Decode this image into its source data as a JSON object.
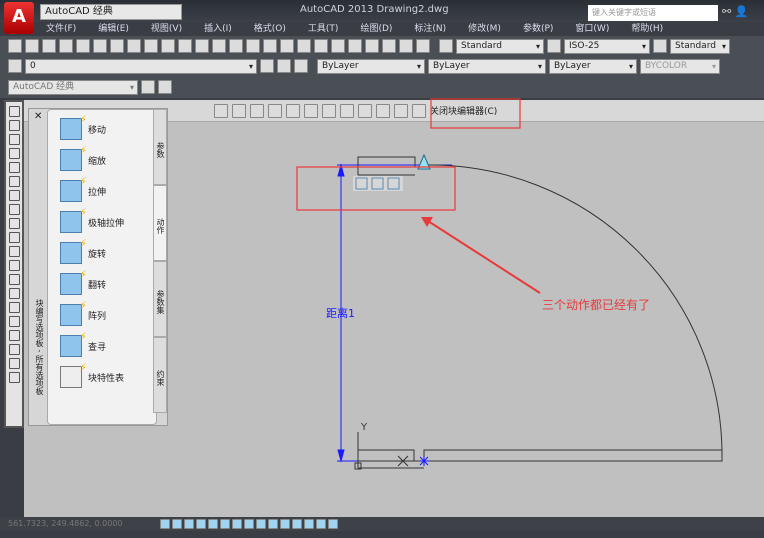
{
  "app": {
    "logo": "A",
    "workspace": "AutoCAD 经典",
    "title": "AutoCAD 2013   Drawing2.dwg",
    "search_placeholder": "键入关键字或短语"
  },
  "menu": [
    "文件(F)",
    "编辑(E)",
    "视图(V)",
    "插入(I)",
    "格式(O)",
    "工具(T)",
    "绘图(D)",
    "标注(N)",
    "修改(M)",
    "参数(P)",
    "窗口(W)",
    "帮助(H)"
  ],
  "styles": {
    "text_style": "Standard",
    "dim_style": "ISO-25",
    "table_style": "Standard"
  },
  "layers": {
    "layer": "0",
    "color": "ByLayer",
    "linetype": "ByLayer",
    "lineweight": "ByLayer",
    "plotstyle": "BYCOLOR"
  },
  "workspace2": "AutoCAD 经典",
  "block_editor": {
    "close_label": "关闭块编辑器(C)"
  },
  "palette": {
    "title": "块编写选项板 - 所有选项板",
    "items": [
      "移动",
      "缩放",
      "拉伸",
      "极轴拉伸",
      "旋转",
      "翻转",
      "阵列",
      "查寻",
      "块特性表"
    ],
    "tabs": [
      "参数",
      "动作",
      "参数集",
      "约束"
    ]
  },
  "drawing": {
    "dim_label": "距离1",
    "annotation": "三个动作都已经有了",
    "ucs_y": "Y",
    "accent_red": "#e8393a",
    "dim_blue": "#1a1aff"
  },
  "status": {
    "coords": "561.7323, 249.4862, 0.0000"
  }
}
